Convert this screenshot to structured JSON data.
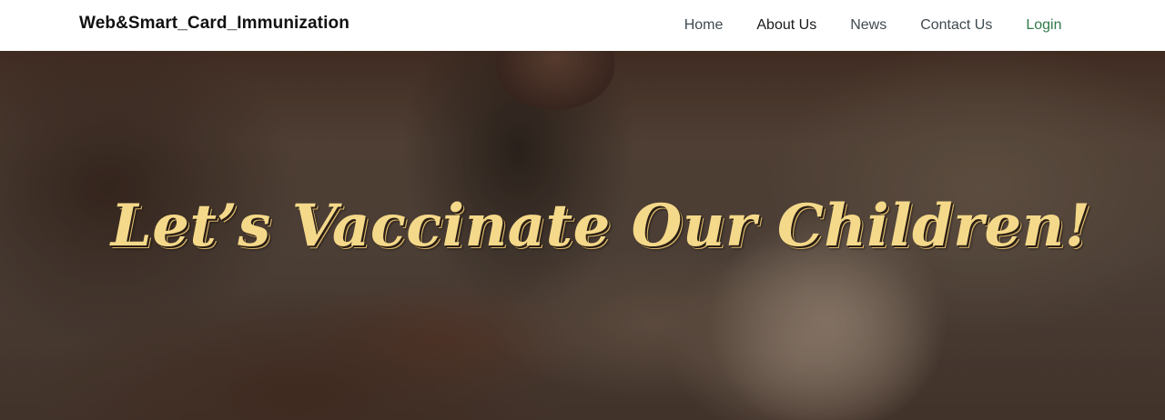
{
  "navbar": {
    "brand": "Web&Smart_Card_Immunization",
    "links": [
      {
        "label": "Home"
      },
      {
        "label": "About Us"
      },
      {
        "label": "News"
      },
      {
        "label": "Contact Us"
      },
      {
        "label": "Login"
      }
    ]
  },
  "hero": {
    "headline": "Let’s Vaccinate Our Children!",
    "image": "baby-receiving-oral-vaccine-photo"
  },
  "colors": {
    "headline": "#f5d98a",
    "login_link": "#2f7a4b",
    "nav_link": "#3f4a50"
  }
}
